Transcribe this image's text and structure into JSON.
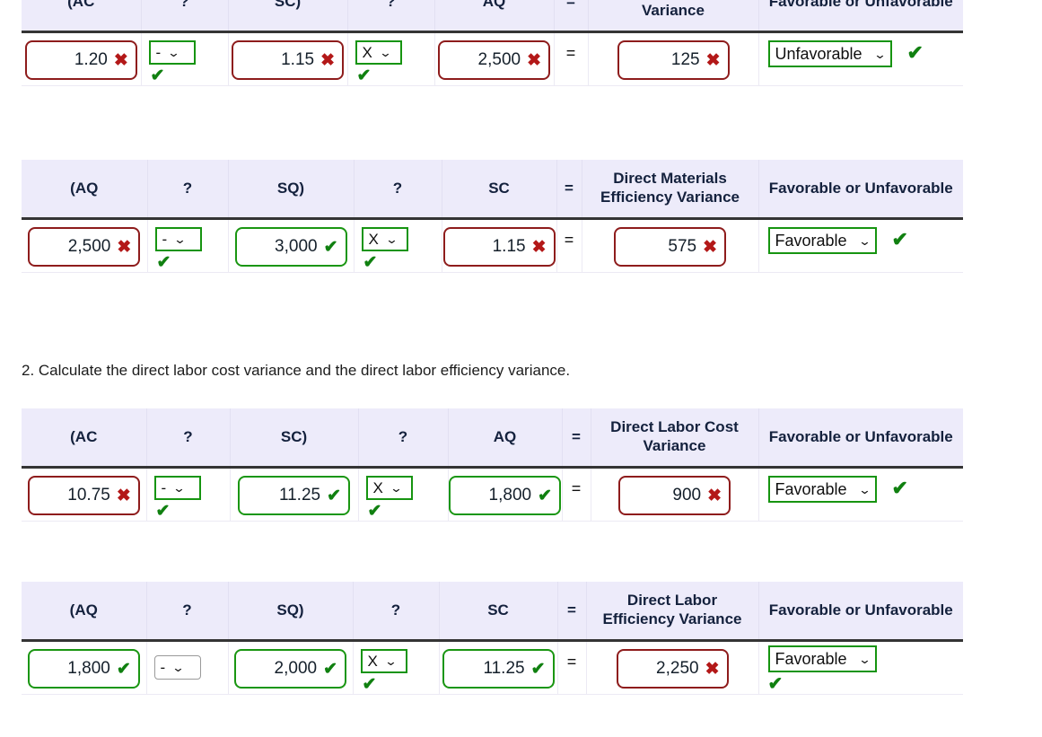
{
  "page": {
    "prompts": [
      {
        "id": "q2",
        "text": "2. Calculate the direct labor cost variance and the direct labor efficiency variance."
      }
    ]
  },
  "icons": {
    "cross": "✖",
    "check": "✔",
    "chevron_down": "⌄"
  },
  "colors": {
    "header_bg": "#edebfa",
    "header_text": "#14213d",
    "wrong_border": "#8e1c1c",
    "right_border": "#1a9612",
    "cross_color": "#b31818",
    "check_color": "#108010",
    "rule_color": "#343434"
  },
  "tables": [
    {
      "id": "dm-cost-variance",
      "headers": [
        "(AC",
        "?",
        "SC)",
        "?",
        "AQ",
        "=",
        "Direct Materials Cost Variance",
        "Favorable or Unfavorable"
      ],
      "row": {
        "ac_value": "1.20",
        "ac_status": "wrong",
        "op1_value": "-",
        "op1_status": "right",
        "sc_value": "1.15",
        "sc_status": "wrong",
        "op2_value": "X",
        "op2_status": "right",
        "aq_value": "2,500",
        "aq_status": "wrong",
        "equals": "=",
        "result_value": "125",
        "result_status": "wrong",
        "fu_value": "Unfavorable",
        "fu_status": "right",
        "fu_layout": "inline"
      }
    },
    {
      "id": "dm-efficiency-variance",
      "headers": [
        "(AQ",
        "?",
        "SQ)",
        "?",
        "SC",
        "=",
        "Direct Materials Efficiency Variance",
        "Favorable or Unfavorable"
      ],
      "row": {
        "ac_value": "2,500",
        "ac_status": "wrong",
        "op1_value": "-",
        "op1_status": "right",
        "sc_value": "3,000",
        "sc_status": "right",
        "op2_value": "X",
        "op2_status": "right",
        "aq_value": "1.15",
        "aq_status": "wrong",
        "equals": "=",
        "result_value": "575",
        "result_status": "wrong",
        "fu_value": "Favorable",
        "fu_status": "right",
        "fu_layout": "inline"
      }
    },
    {
      "id": "dl-cost-variance",
      "headers": [
        "(AC",
        "?",
        "SC)",
        "?",
        "AQ",
        "=",
        "Direct Labor Cost Variance",
        "Favorable or Unfavorable"
      ],
      "row": {
        "ac_value": "10.75",
        "ac_status": "wrong",
        "op1_value": "-",
        "op1_status": "right",
        "sc_value": "11.25",
        "sc_status": "right",
        "op2_value": "X",
        "op2_status": "right",
        "aq_value": "1,800",
        "aq_status": "right",
        "equals": "=",
        "result_value": "900",
        "result_status": "wrong",
        "fu_value": "Favorable",
        "fu_status": "right",
        "fu_layout": "inline"
      }
    },
    {
      "id": "dl-efficiency-variance",
      "headers": [
        "(AQ",
        "?",
        "SQ)",
        "?",
        "SC",
        "=",
        "Direct Labor Efficiency Variance",
        "Favorable or Unfavorable"
      ],
      "row": {
        "ac_value": "1,800",
        "ac_status": "right",
        "op1_value": "-",
        "op1_status": "none",
        "sc_value": "2,000",
        "sc_status": "right",
        "op2_value": "X",
        "op2_status": "right",
        "aq_value": "11.25",
        "aq_status": "right",
        "equals": "=",
        "result_value": "2,250",
        "result_status": "wrong",
        "fu_value": "Favorable",
        "fu_status": "right",
        "fu_layout": "stacked"
      }
    }
  ]
}
